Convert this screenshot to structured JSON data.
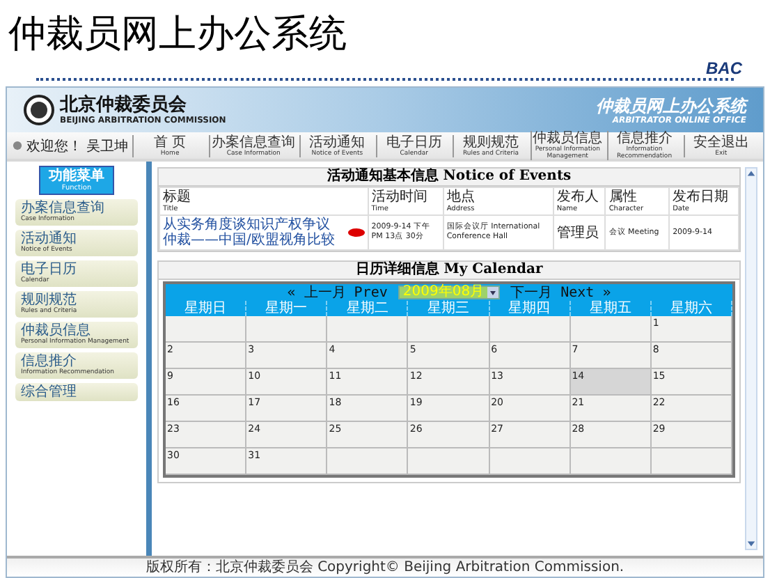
{
  "slide": {
    "title": "仲裁员网上办公系统",
    "tag": "BAC"
  },
  "banner": {
    "org_cn": "北京仲裁委员会",
    "org_en": "BEIJING ARBITRATION COMMISSION",
    "system_cn": "仲裁员网上办公系统",
    "system_en": "ARBITRATOR ONLINE OFFICE"
  },
  "user": {
    "greeting": "欢迎您！",
    "name": "吴卫坤"
  },
  "nav": [
    {
      "cn": "首 页",
      "en": "Home"
    },
    {
      "cn": "办案信息查询",
      "en": "Case Information"
    },
    {
      "cn": "活动通知",
      "en": "Notice of Events"
    },
    {
      "cn": "电子日历",
      "en": "Calendar"
    },
    {
      "cn": "规则规范",
      "en": "Rules and Criteria"
    },
    {
      "cn": "仲裁员信息",
      "en": "Personal Information Management"
    },
    {
      "cn": "信息推介",
      "en": "Information Recommendation"
    },
    {
      "cn": "安全退出",
      "en": "Exit"
    }
  ],
  "sidebar": {
    "header_cn": "功能菜单",
    "header_en": "Function",
    "items": [
      {
        "cn": "办案信息查询",
        "en": "Case Information"
      },
      {
        "cn": "活动通知",
        "en": "Notice of Events"
      },
      {
        "cn": "电子日历",
        "en": "Calendar"
      },
      {
        "cn": "规则规范",
        "en": "Rules and Criteria"
      },
      {
        "cn": "仲裁员信息",
        "en": "Personal Information Management"
      },
      {
        "cn": "信息推介",
        "en": "Information Recommendation"
      },
      {
        "cn": "综合管理"
      }
    ]
  },
  "events": {
    "title": "活动通知基本信息 Notice of Events",
    "columns": [
      {
        "cn": "标题",
        "en": "Title"
      },
      {
        "cn": "活动时间",
        "en": "Time"
      },
      {
        "cn": "地点",
        "en": "Address"
      },
      {
        "cn": "发布人",
        "en": "Name"
      },
      {
        "cn": "属性",
        "en": "Character"
      },
      {
        "cn": "发布日期",
        "en": "Date"
      }
    ],
    "rows": [
      {
        "title": "从实务角度谈知识产权争议仲裁——中国/欧盟视角比较",
        "is_new": true,
        "time": "2009-9-14 下午 PM 13点 30分",
        "address": "国际会议厅 International Conference Hall",
        "name": "管理员",
        "character": "会议 Meeting",
        "date": "2009-9-14"
      }
    ]
  },
  "calendar": {
    "title": "日历详细信息 My Calendar",
    "prev": "« 上一月 Prev",
    "month": "2009年08月",
    "next": "下一月 Next »",
    "weekdays": [
      "星期日",
      "星期一",
      "星期二",
      "星期三",
      "星期四",
      "星期五",
      "星期六"
    ],
    "weeks": [
      {
        "kind": "first",
        "days": [
          {
            "day": "1",
            "selected": false
          }
        ]
      },
      {
        "kind": "full",
        "days": [
          {
            "day": "2",
            "selected": false
          },
          {
            "day": "3",
            "selected": false
          },
          {
            "day": "4",
            "selected": false
          },
          {
            "day": "5",
            "selected": false
          },
          {
            "day": "6",
            "selected": false
          },
          {
            "day": "7",
            "selected": false
          },
          {
            "day": "8",
            "selected": false
          }
        ]
      },
      {
        "kind": "full",
        "days": [
          {
            "day": "9",
            "selected": false
          },
          {
            "day": "10",
            "selected": false
          },
          {
            "day": "11",
            "selected": false
          },
          {
            "day": "12",
            "selected": false
          },
          {
            "day": "13",
            "selected": false
          },
          {
            "day": "14",
            "selected": true
          },
          {
            "day": "15",
            "selected": false
          }
        ]
      },
      {
        "kind": "full",
        "days": [
          {
            "day": "16",
            "selected": false
          },
          {
            "day": "17",
            "selected": false
          },
          {
            "day": "18",
            "selected": false
          },
          {
            "day": "19",
            "selected": false
          },
          {
            "day": "20",
            "selected": false
          },
          {
            "day": "21",
            "selected": false
          },
          {
            "day": "22",
            "selected": false
          }
        ]
      },
      {
        "kind": "full",
        "days": [
          {
            "day": "23",
            "selected": false
          },
          {
            "day": "24",
            "selected": false
          },
          {
            "day": "25",
            "selected": false
          },
          {
            "day": "26",
            "selected": false
          },
          {
            "day": "27",
            "selected": false
          },
          {
            "day": "28",
            "selected": false
          },
          {
            "day": "29",
            "selected": false
          }
        ]
      },
      {
        "kind": "last",
        "days": [
          {
            "day": "30",
            "selected": false
          },
          {
            "day": "31",
            "selected": false
          }
        ]
      }
    ]
  },
  "footer": "版权所有：北京仲裁委员会 Copyright© Beijing Arbitration Commission."
}
